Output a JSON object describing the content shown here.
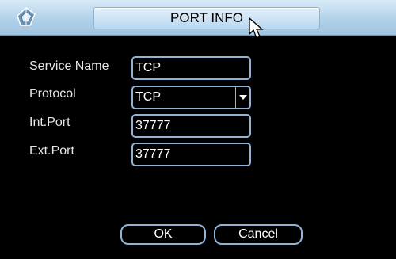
{
  "window": {
    "title": "PORT INFO",
    "icons": {
      "app": "logo-icon",
      "cursor": "mouse-pointer-icon",
      "dropdown": "chevron-down-icon"
    }
  },
  "form": {
    "service_name": {
      "label": "Service Name",
      "value": "TCP"
    },
    "protocol": {
      "label": "Protocol",
      "value": "TCP"
    },
    "int_port": {
      "label": "Int.Port",
      "value": "37777"
    },
    "ext_port": {
      "label": "Ext.Port",
      "value": "37777"
    }
  },
  "buttons": {
    "ok": "OK",
    "cancel": "Cancel"
  },
  "colors": {
    "titlebar": "#aecfe8",
    "background": "#000000",
    "field_border": "#8fb4d6",
    "text": "#e6e6e6"
  }
}
